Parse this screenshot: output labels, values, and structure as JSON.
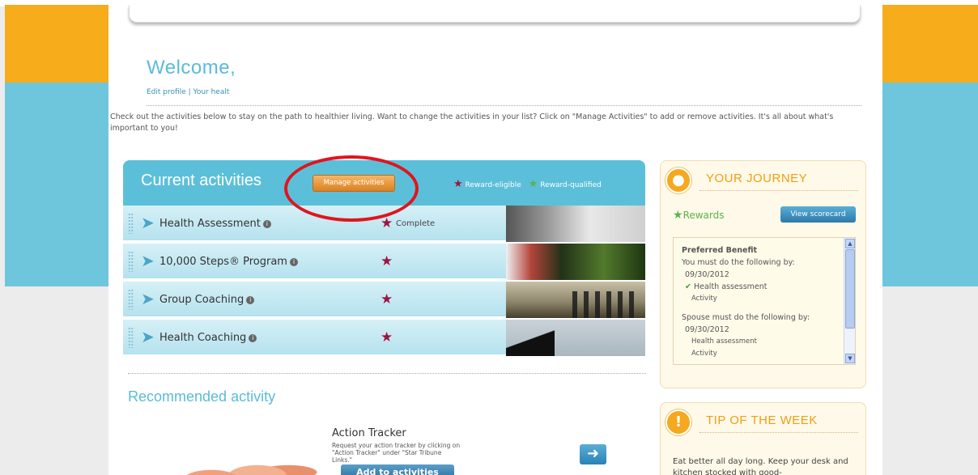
{
  "welcome": {
    "title": "Welcome, ",
    "edit_profile": "Edit profile",
    "separator": "|",
    "your_health": "Your healt"
  },
  "intro": "Check out the activities below to stay on the path to healthier living. Want to change the activities in your list? Click on \"Manage Activities\" to add or remove activities. It's all about what's important to you!",
  "current_activities": {
    "title": "Current activities",
    "manage_label": "Manage activities",
    "legend_eligible": "Reward-eligible",
    "legend_qualified": "Reward-qualified",
    "items": [
      {
        "name": "Health Assessment",
        "status": "Complete"
      },
      {
        "name": "10,000 Steps® Program",
        "status": ""
      },
      {
        "name": "Group Coaching",
        "status": ""
      },
      {
        "name": "Health Coaching",
        "status": ""
      }
    ]
  },
  "recommended": {
    "title": "Recommended activity",
    "activity_title": "Action Tracker",
    "activity_desc": "Request your action tracker by clicking on \"Action Tracker\" under \"Star Tribune Links.\"",
    "add_label": "Add to activities"
  },
  "journey": {
    "title": "YOUR JOURNEY",
    "rewards_label": "Rewards",
    "view_label": "View scorecard",
    "benefit_title": "Preferred Benefit",
    "you_line": "You must do the following by:",
    "you_date": "09/30/2012",
    "you_item1": "Health assessment",
    "you_item2": "Activity",
    "spouse_line": "Spouse must do the following by:",
    "spouse_date": "09/30/2012",
    "spouse_item1": "Health assessment",
    "spouse_item2": "Activity"
  },
  "tip": {
    "title": "TIP OF THE WEEK",
    "text": "Eat better all day long. Keep your desk and kitchen stocked with good-"
  },
  "colors": {
    "accent_blue": "#5cbfda",
    "orange": "#f7ac1b",
    "reward_eligible": "#9b1640",
    "reward_qualified": "#5ab24a",
    "annotation_red": "#e0151d"
  }
}
